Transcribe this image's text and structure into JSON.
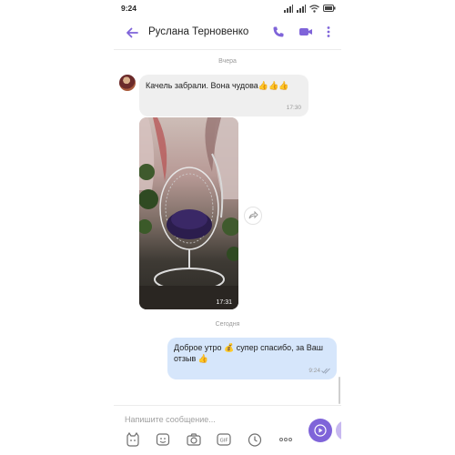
{
  "status": {
    "time": "9:24"
  },
  "header": {
    "contact_name": "Руслана Терновенко"
  },
  "separators": {
    "yesterday": "Вчера",
    "today": "Сегодня"
  },
  "messages": [
    {
      "direction": "incoming",
      "text": "Качель забрали. Вона чудова👍👍👍",
      "time": "17:30"
    },
    {
      "direction": "incoming",
      "type": "video",
      "time": "17:31"
    },
    {
      "direction": "outgoing",
      "text": "Доброе утро 💰 супер спасибо, за Ваш отзыв 👍",
      "time": "9:24"
    }
  ],
  "composer": {
    "placeholder": "Напишите сообщение..."
  },
  "colors": {
    "accent": "#7f64d9",
    "incoming_bubble": "#efefef",
    "outgoing_bubble": "#d6e6fb"
  },
  "icons": [
    "back-arrow-icon",
    "phone-icon",
    "video-call-icon",
    "more-vertical-icon",
    "share-icon",
    "sticker-icon",
    "emoji-icon",
    "camera-icon",
    "gif-icon",
    "timer-icon",
    "more-horizontal-icon",
    "send-icon"
  ]
}
